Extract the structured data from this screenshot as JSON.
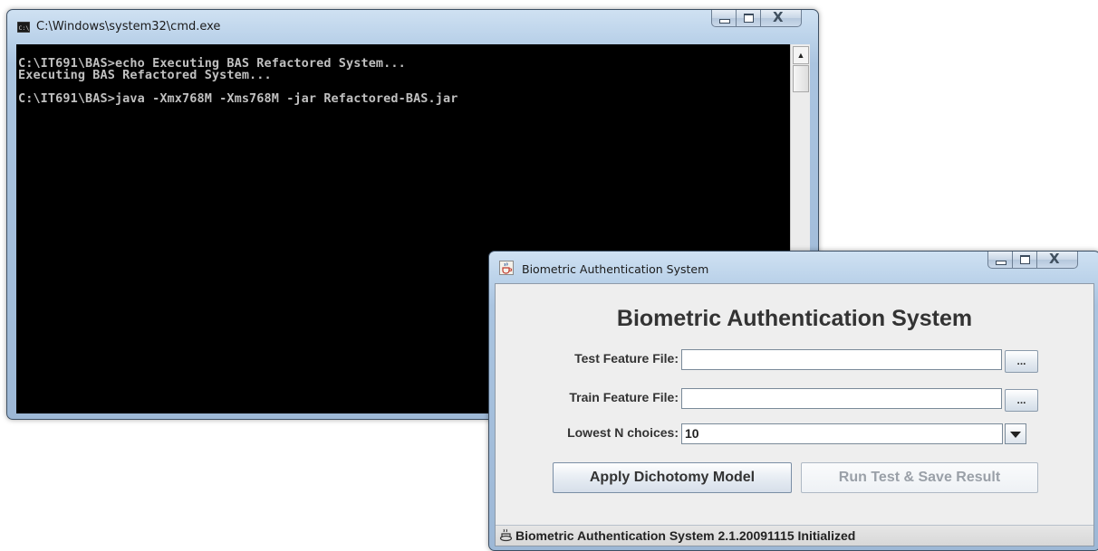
{
  "cmd_window": {
    "title": "C:\\Windows\\system32\\cmd.exe",
    "icon_label": "C:\\",
    "console_lines": [
      "C:\\IT691\\BAS>echo Executing BAS Refactored System...",
      "Executing BAS Refactored System...",
      "",
      "C:\\IT691\\BAS>java -Xmx768M -Xms768M -jar Refactored-BAS.jar"
    ],
    "scroll_up_glyph": "▲"
  },
  "java_window": {
    "title": "Biometric Authentication System",
    "heading": "Biometric Authentication System",
    "test_label": "Test Feature File:",
    "test_value": "",
    "train_label": "Train Feature File:",
    "train_value": "",
    "browse_label": "...",
    "lowest_label": "Lowest N choices:",
    "lowest_value": "10",
    "apply_button": "Apply Dichotomy Model",
    "run_button": "Run Test & Save Result",
    "status": "Biometric Authentication System 2.1.20091115 Initialized"
  },
  "caption_buttons": {
    "close_glyph": "X"
  },
  "colors": {
    "console_bg": "#000000",
    "console_text": "#c0c0c0",
    "frame_accent": "#aac4e0",
    "app_bg": "#eeeeee"
  }
}
